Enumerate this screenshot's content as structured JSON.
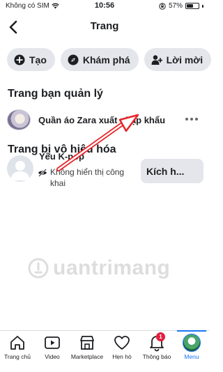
{
  "status_bar": {
    "carrier": "Không có SIM",
    "time": "10:56",
    "battery": "57%",
    "battery_level": 0.57
  },
  "header": {
    "title": "Trang"
  },
  "chips": [
    {
      "label": "Tạo",
      "icon": "plus-circle-icon"
    },
    {
      "label": "Khám phá",
      "icon": "compass-icon"
    },
    {
      "label": "Lời mời",
      "icon": "person-add-icon"
    }
  ],
  "managed": {
    "title": "Trang bạn quản lý",
    "page_name": "Quần áo Zara xuất nhập khẩu"
  },
  "deactivated": {
    "title": "Trang bị vô hiệu hóa",
    "page_name": "Yêu K-pop",
    "status": "Không hiển thị công khai",
    "action_label": "Kích h..."
  },
  "watermark": {
    "text": "uantrimang"
  },
  "bottom_nav": [
    {
      "label": "Trang chủ",
      "icon": "home-icon"
    },
    {
      "label": "Video",
      "icon": "video-icon"
    },
    {
      "label": "Marketplace",
      "icon": "marketplace-icon"
    },
    {
      "label": "Hẹn hò",
      "icon": "heart-icon"
    },
    {
      "label": "Thông báo",
      "icon": "bell-icon",
      "badge": "1"
    },
    {
      "label": "Menu",
      "icon": "menu-avatar-icon",
      "active": true
    }
  ],
  "colors": {
    "accent": "#1877f2",
    "badge": "#e41e3f",
    "annotation": "#e8262a"
  }
}
